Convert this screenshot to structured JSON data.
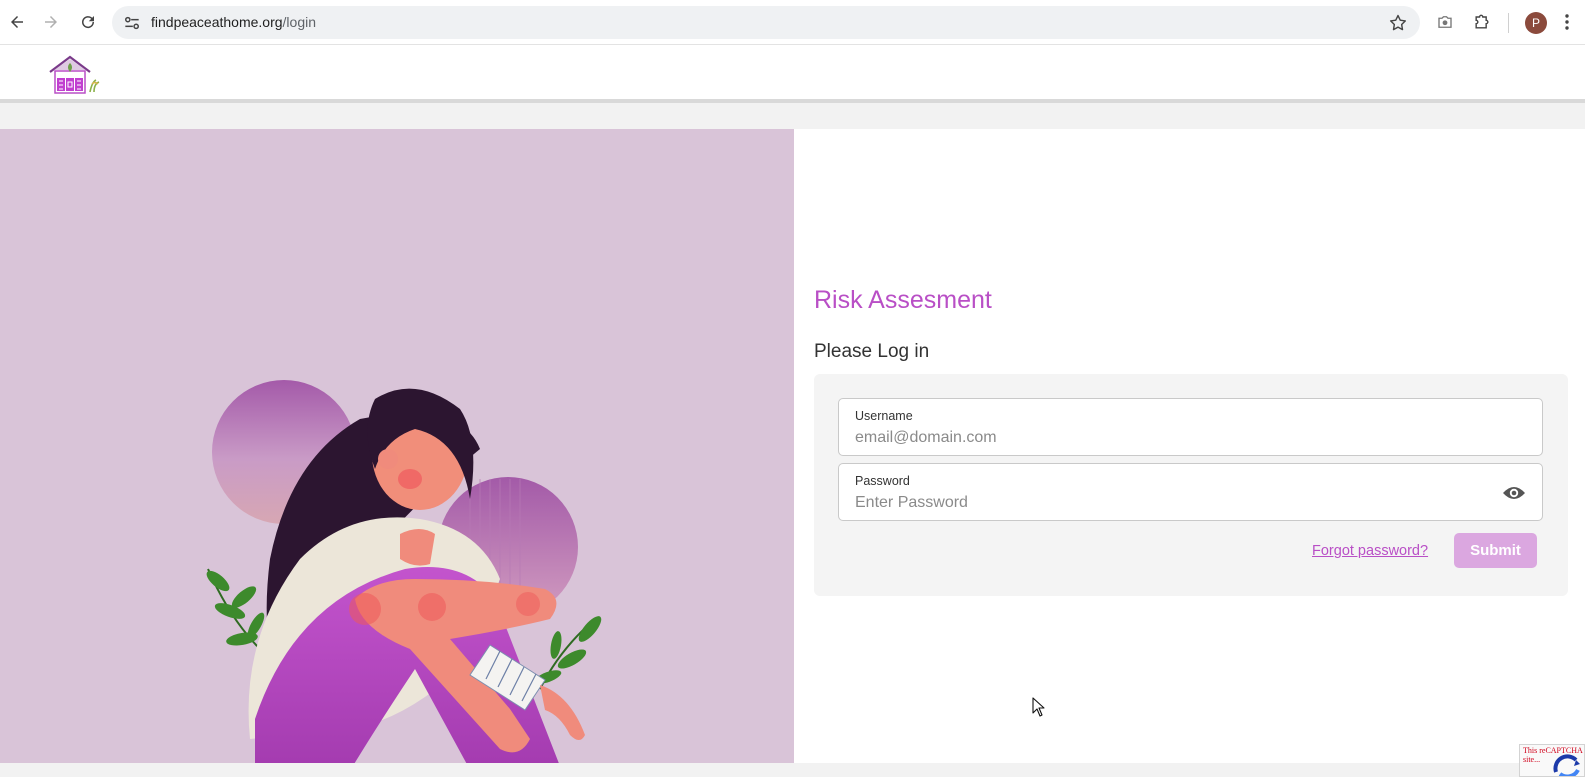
{
  "browser": {
    "url_host": "findpeaceathome.org",
    "url_path": "/login",
    "avatar_letter": "P"
  },
  "login": {
    "title": "Risk Assesment",
    "subtitle": "Please Log in",
    "username_label": "Username",
    "username_placeholder": "email@domain.com",
    "password_label": "Password",
    "password_placeholder": "Enter Password",
    "forgot_label": "Forgot password?",
    "submit_label": "Submit"
  },
  "recaptcha": {
    "text": "This reCAPTCHA site..."
  },
  "colors": {
    "accent": "#b94fc6",
    "submit_disabled": "#dba7e0",
    "hero_bg": "#d9c4d8"
  }
}
